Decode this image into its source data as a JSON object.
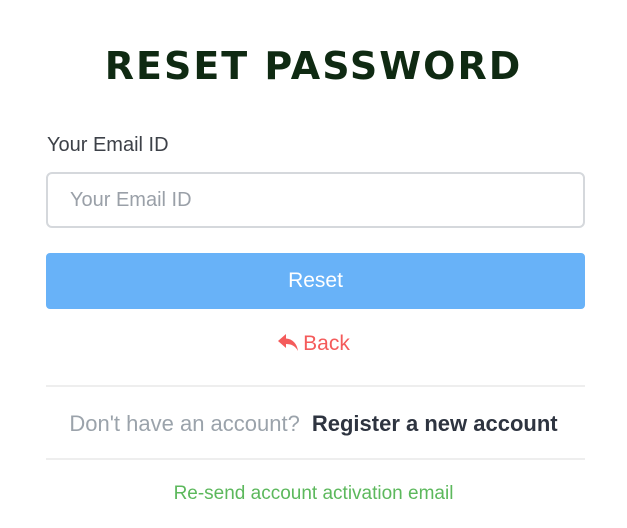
{
  "title": "RESET PASSWORD",
  "email": {
    "label": "Your Email ID",
    "placeholder": "Your Email ID",
    "value": ""
  },
  "reset_button": {
    "label": "Reset",
    "color": "#68b2f8"
  },
  "back_link": {
    "label": "Back",
    "icon": "reply-arrow-icon",
    "color": "#f45b5b"
  },
  "register": {
    "prompt": "Don't have an account?",
    "link_label": "Register a new account"
  },
  "resend_link": {
    "label": "Re-send account activation email",
    "color": "#5cb85c"
  }
}
